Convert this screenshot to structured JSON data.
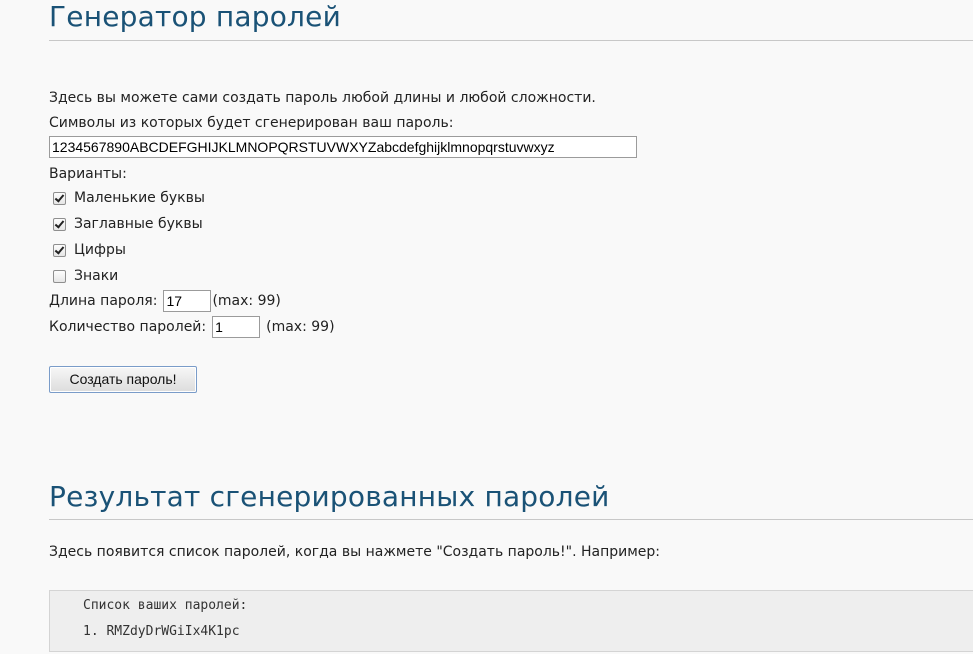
{
  "generator": {
    "title": "Генератор паролей",
    "intro": "Здесь вы можете сами создать пароль любой длины и любой сложности.",
    "symbols_label": "Символы из которых будет сгенерирован ваш пароль:",
    "symbols_value": "1234567890ABCDEFGHIJKLMNOPQRSTUVWXYZabcdefghijklmnopqrstuvwxyz",
    "variants_label": "Варианты:",
    "options": [
      {
        "label": "Маленькие буквы",
        "checked": true
      },
      {
        "label": "Заглавные буквы",
        "checked": true
      },
      {
        "label": "Цифры",
        "checked": true
      },
      {
        "label": "Знаки",
        "checked": false
      }
    ],
    "length_label": "Длина пароля:",
    "length_value": "17",
    "length_max": "(max: 99)",
    "count_label": "Количество паролей:",
    "count_value": "1",
    "count_max": "(max: 99)",
    "create_button": "Создать пароль!"
  },
  "results": {
    "title": "Результат сгенерированных паролей",
    "hint": "Здесь появится список паролей, когда вы нажмете \"Создать пароль!\". Например:",
    "list_title": "Список ваших паролей:",
    "items": [
      {
        "number": "1.",
        "password": "RMZdyDrWGiIx4K1pc"
      }
    ]
  },
  "colors": {
    "heading": "#1a5276",
    "background": "#f9f9f9",
    "result_box": "#eeeeee"
  }
}
